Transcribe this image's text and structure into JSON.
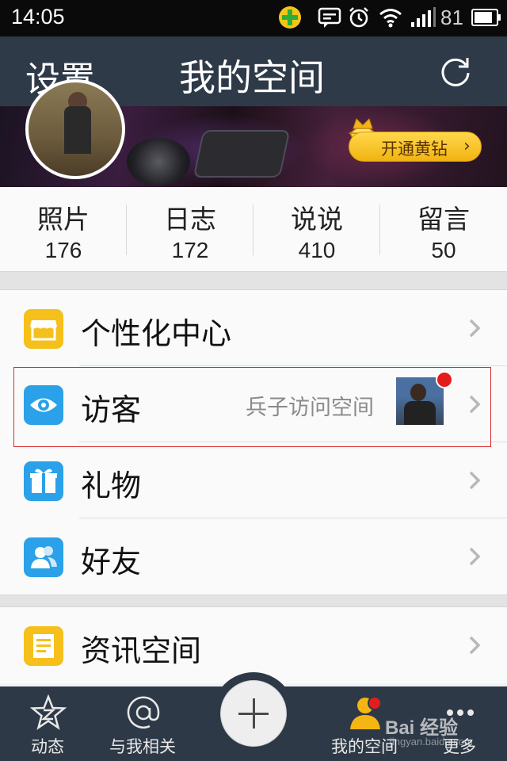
{
  "status_bar": {
    "time": "14:05",
    "battery_level": "81",
    "icons": [
      "360-security-icon",
      "message-icon",
      "alarm-icon",
      "wifi-icon",
      "signal-icon",
      "battery-icon"
    ]
  },
  "header": {
    "left_button": "设置",
    "title": "我的空间",
    "right_icon": "refresh-icon"
  },
  "cover": {
    "vip_button": "开通黄钻",
    "vip_icon": "yellow-diamond-crown-icon"
  },
  "stats": [
    {
      "label": "照片",
      "count": "176"
    },
    {
      "label": "日志",
      "count": "172"
    },
    {
      "label": "说说",
      "count": "410"
    },
    {
      "label": "留言",
      "count": "50"
    }
  ],
  "menu": [
    {
      "label": "个性化中心",
      "icon": "store-icon",
      "icon_color": "#f5c01b"
    },
    {
      "label": "访客",
      "icon": "eye-icon",
      "icon_color": "#2aa1e8",
      "subtitle": "兵子访问空间",
      "has_thumbnail": true,
      "has_badge": true
    },
    {
      "label": "礼物",
      "icon": "gift-icon",
      "icon_color": "#2aa1e8"
    },
    {
      "label": "好友",
      "icon": "friends-icon",
      "icon_color": "#2aa1e8"
    }
  ],
  "menu2": [
    {
      "label": "资讯空间",
      "icon": "news-icon",
      "icon_color": "#f5c01b"
    }
  ],
  "tab_bar": {
    "tabs": [
      {
        "label": "动态",
        "icon": "star-z-icon"
      },
      {
        "label": "与我相关",
        "icon": "at-icon"
      },
      {
        "label": "我的空间",
        "icon": "profile-icon",
        "active": true,
        "has_badge": true
      },
      {
        "label": "更多",
        "icon": "more-icon"
      }
    ],
    "fab_icon": "plus-icon"
  },
  "watermark": {
    "brand": "Bai 经验",
    "url": "jingyan.baidu.com"
  },
  "colors": {
    "header_bg": "#2f3a48",
    "accent_yellow": "#f5c01b",
    "accent_blue": "#2aa1e8",
    "badge_red": "#e21d1d"
  }
}
